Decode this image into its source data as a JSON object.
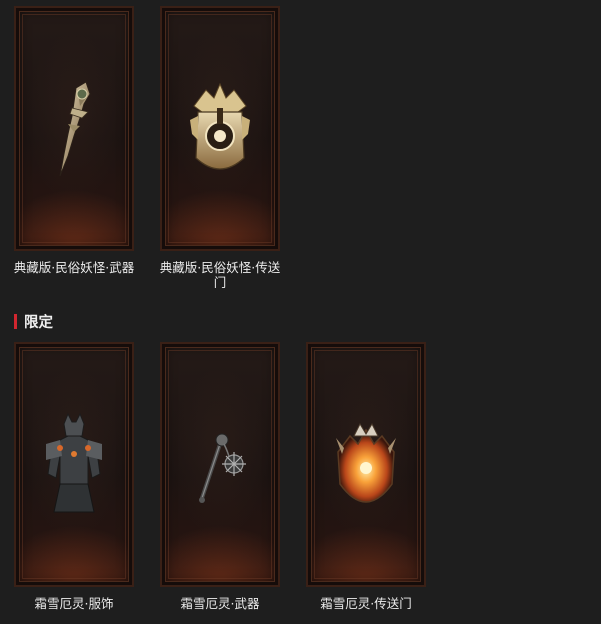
{
  "rows": [
    {
      "section_title": "",
      "items": [
        {
          "name": "典藏版·民俗妖怪·武器",
          "icon": "dagger-weapon-icon"
        },
        {
          "name": "典藏版·民俗妖怪·传送门",
          "icon": "portal-icon"
        }
      ]
    }
  ],
  "limited": {
    "section_title": "限定",
    "accent_color": "#d2262f",
    "items": [
      {
        "name": "霜雪厄灵·服饰",
        "icon": "armor-figure-icon"
      },
      {
        "name": "霜雪厄灵·武器",
        "icon": "flail-weapon-icon"
      },
      {
        "name": "霜雪厄灵·传送门",
        "icon": "fire-portal-icon"
      }
    ]
  }
}
